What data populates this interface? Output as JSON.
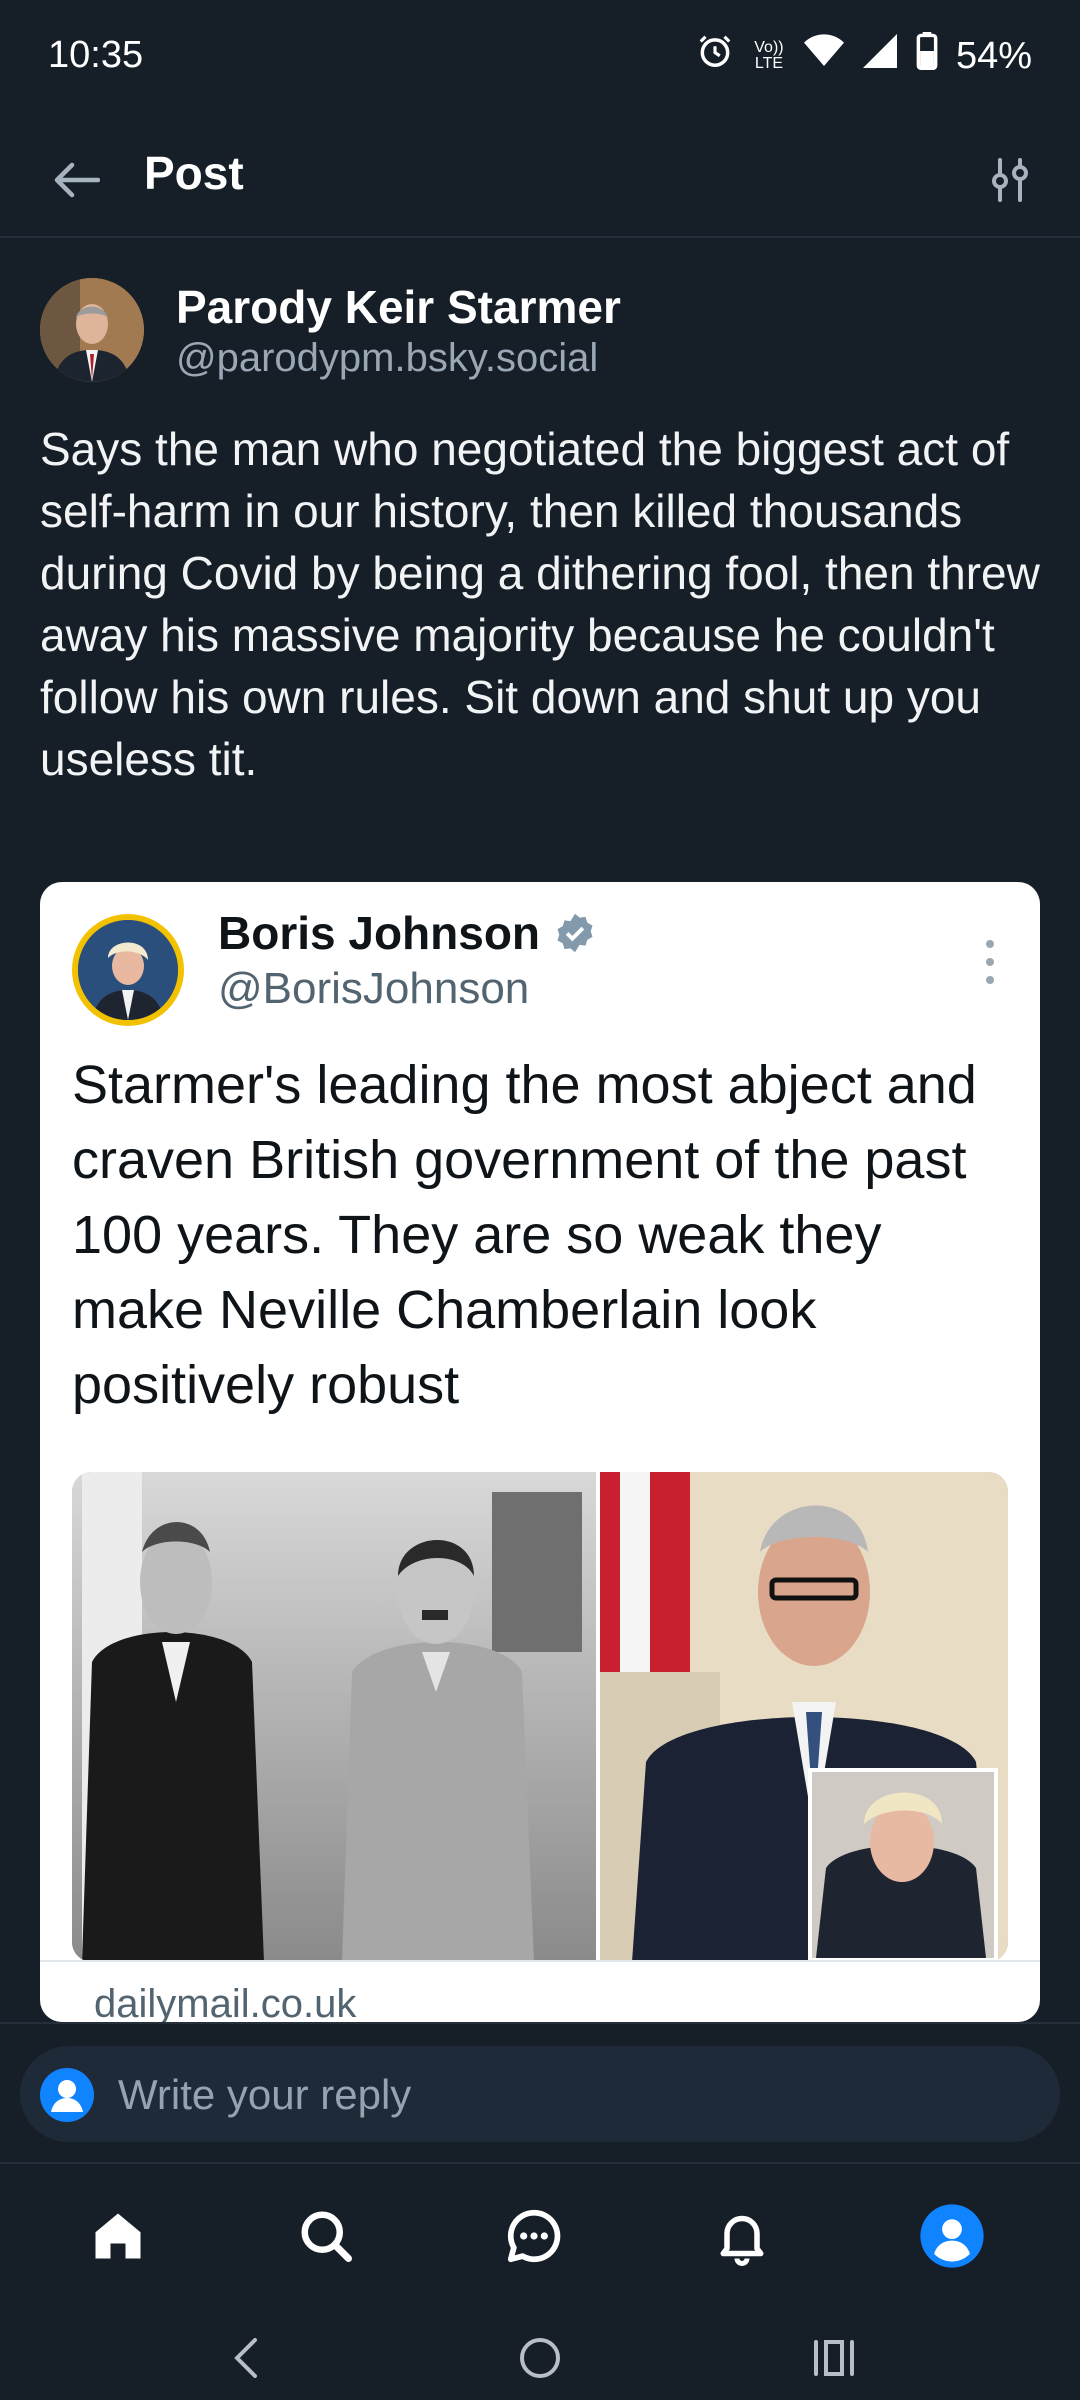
{
  "status_bar": {
    "time": "10:35",
    "network": "Vo)) LTE",
    "battery": "54%"
  },
  "header": {
    "title": "Post"
  },
  "post": {
    "author_name": "Parody Keir Starmer",
    "author_handle": "@parodypm.bsky.social",
    "text": "Says the man who negotiated the biggest act of self-harm in our history, then killed thousands during Covid by being a dithering fool, then threw away his massive majority because he couldn't follow his own rules. Sit down and shut up you useless tit."
  },
  "quoted": {
    "name": "Boris Johnson",
    "handle": "@BorisJohnson",
    "text": "Starmer's leading the most abject and craven British government of the past 100 years. They are so weak they make Neville Chamberlain look positively robust",
    "link_domain": "dailymail.co.uk"
  },
  "reply": {
    "placeholder": "Write your reply"
  },
  "icons": {
    "back": "arrow-left-icon",
    "filter": "sliders-icon",
    "verified": "verified-badge-icon",
    "more": "more-vertical-icon",
    "home": "home-icon",
    "search": "search-icon",
    "chat": "chat-icon",
    "notifications": "bell-icon",
    "profile": "profile-icon"
  },
  "colors": {
    "background": "#161e27",
    "accent": "#1083fe",
    "card": "#ffffff",
    "muted": "#9aa7b5"
  }
}
